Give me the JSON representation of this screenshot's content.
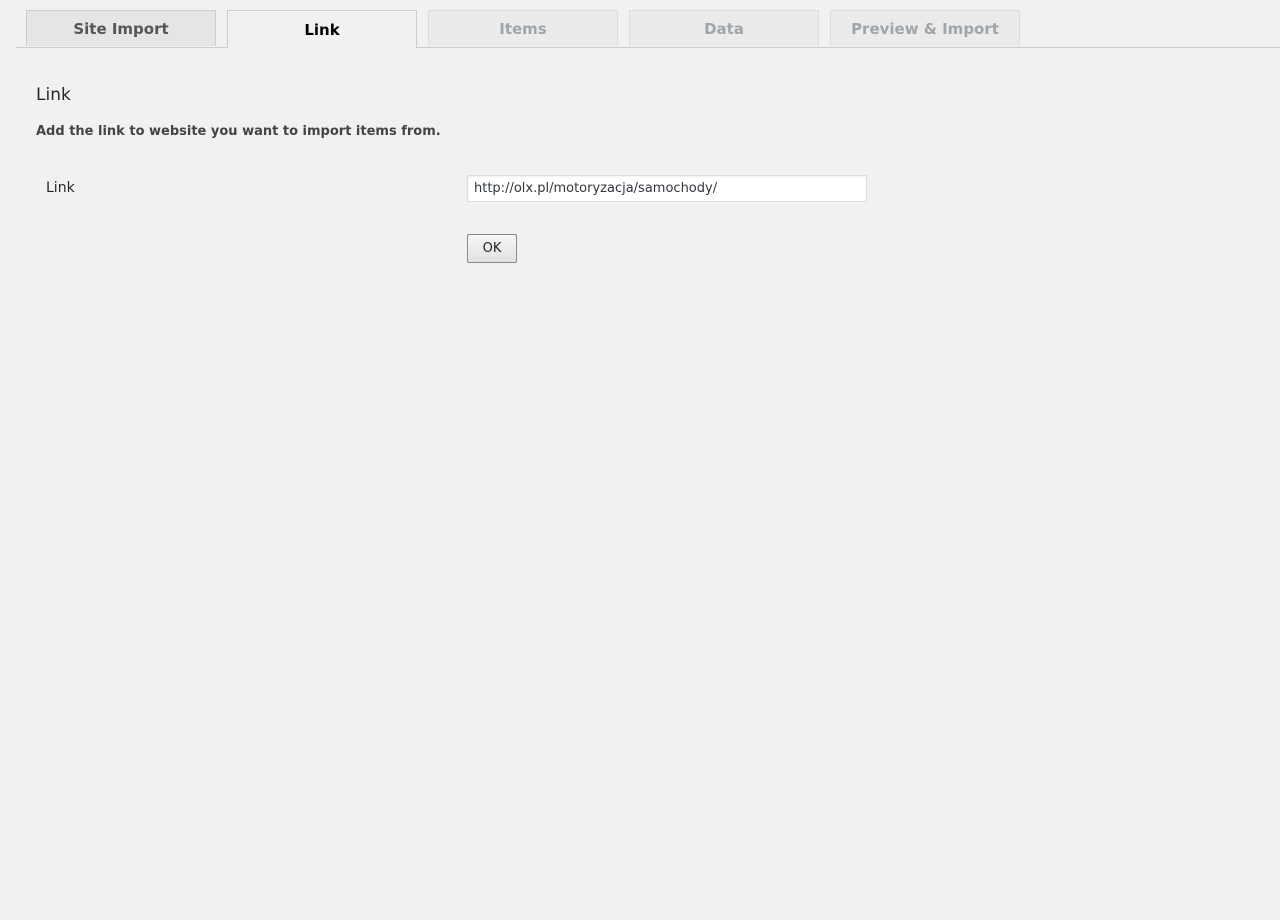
{
  "tabs": [
    {
      "label": "Site Import",
      "state": "normal"
    },
    {
      "label": "Link",
      "state": "active"
    },
    {
      "label": "Items",
      "state": "disabled"
    },
    {
      "label": "Data",
      "state": "disabled"
    },
    {
      "label": "Preview & Import",
      "state": "disabled"
    }
  ],
  "section": {
    "title": "Link",
    "description": "Add the link to website you want to import items from."
  },
  "form": {
    "link_label": "Link",
    "link_value": "http://olx.pl/motoryzacja/samochody/",
    "ok_label": "OK"
  },
  "colors": {
    "background": "#f1f1f1",
    "active_tab_text": "#000000",
    "disabled_tab_text": "#a0a5aa"
  }
}
